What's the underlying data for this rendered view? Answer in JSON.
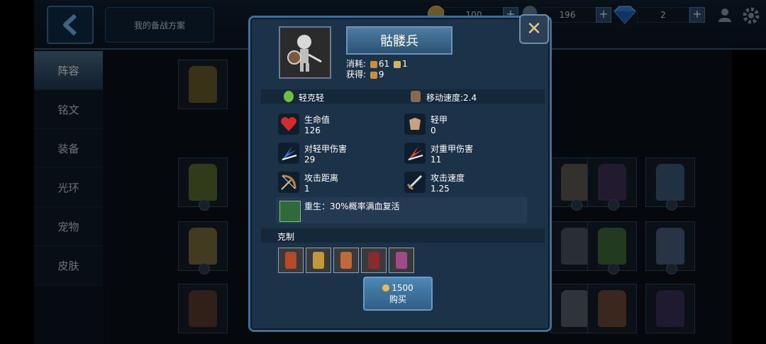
{
  "topbar": {
    "plan_label": "我的备战方案",
    "currency1_value": "100",
    "currency2_value": "196",
    "gem_value": "2"
  },
  "sidebar": {
    "items": [
      {
        "label": "阵容",
        "active": true
      },
      {
        "label": "铭文",
        "active": false
      },
      {
        "label": "装备",
        "active": false
      },
      {
        "label": "光环",
        "active": false
      },
      {
        "label": "宠物",
        "active": false
      },
      {
        "label": "皮肤",
        "active": false
      }
    ]
  },
  "unit": {
    "name": "骷髅兵",
    "cost_label": "消耗:",
    "cost_value": "61",
    "cost_value2": "1",
    "gain_label": "获得:",
    "gain_value": "9",
    "armor_class": "轻克轻",
    "move_speed": "移动速度:2.4",
    "stats": {
      "hp_label": "生命值",
      "hp_value": "126",
      "armor_label": "轻甲",
      "armor_value": "0",
      "light_dmg_label": "对轻甲伤害",
      "light_dmg_value": "29",
      "heavy_dmg_label": "对重甲伤害",
      "heavy_dmg_value": "11",
      "range_label": "攻击距离",
      "range_value": "1",
      "atk_speed_label": "攻击速度",
      "atk_speed_value": "1.25"
    },
    "passive": "重生：30%概率满血复活",
    "counter_label": "克制",
    "buy_price": "1500",
    "buy_label": "购买"
  },
  "colors": {
    "accent": "#3e6f98",
    "gold": "#e7c046"
  },
  "icons": [
    "back-arrow-icon",
    "coin-icon",
    "gem-icon",
    "profile-icon",
    "settings-icon",
    "close-icon",
    "heart-icon",
    "armor-icon",
    "light-slash-icon",
    "heavy-slash-icon",
    "bow-icon",
    "sword-icon",
    "revive-icon"
  ]
}
